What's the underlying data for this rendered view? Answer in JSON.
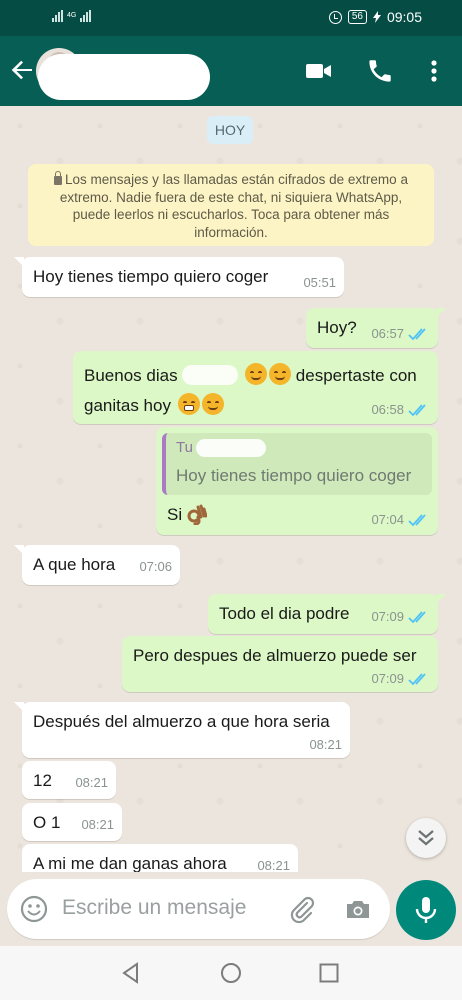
{
  "status_bar": {
    "network_label": "4G",
    "battery": "56",
    "time": "09:05"
  },
  "header": {
    "contact_name": ""
  },
  "chat": {
    "date_label": "HOY",
    "encryption_notice": "Los mensajes y las llamadas están cifrados de extremo a extremo. Nadie fuera de este chat, ni siquiera WhatsApp, puede leerlos ni escucharlos. Toca para obtener más información.",
    "messages": [
      {
        "dir": "in",
        "text": "Hoy tienes tiempo quiero coger",
        "time": "05:51"
      },
      {
        "dir": "out",
        "text": "Hoy?",
        "time": "06:57",
        "read": true
      },
      {
        "dir": "out",
        "text_part1": "Buenos dias",
        "text_part2": "despertaste con",
        "text_part3": "ganitas hoy",
        "time": "06:58",
        "read": true
      },
      {
        "dir": "out",
        "quote_author": "Tu",
        "quote_text": "Hoy tienes tiempo quiero coger",
        "text": "Si",
        "time": "07:04",
        "read": true
      },
      {
        "dir": "in",
        "text": "A que hora",
        "time": "07:06"
      },
      {
        "dir": "out",
        "text": "Todo el dia podre",
        "time": "07:09",
        "read": true
      },
      {
        "dir": "out",
        "text": "Pero despues de almuerzo puede ser",
        "time": "07:09",
        "read": true
      },
      {
        "dir": "in",
        "text": "Después del almuerzo a que hora seria",
        "time": "08:21"
      },
      {
        "dir": "in",
        "text": "12",
        "time": "08:21"
      },
      {
        "dir": "in",
        "text": "O 1",
        "time": "08:21"
      },
      {
        "dir": "in",
        "text": "A mi me dan ganas ahora",
        "time": "08:21"
      }
    ]
  },
  "composer": {
    "placeholder": "Escribe un mensaje"
  },
  "colors": {
    "header": "#075e54",
    "outgoing": "#dcf8c6",
    "incoming": "#ffffff",
    "ticks": "#4fc3f7",
    "fab": "#00897b"
  }
}
